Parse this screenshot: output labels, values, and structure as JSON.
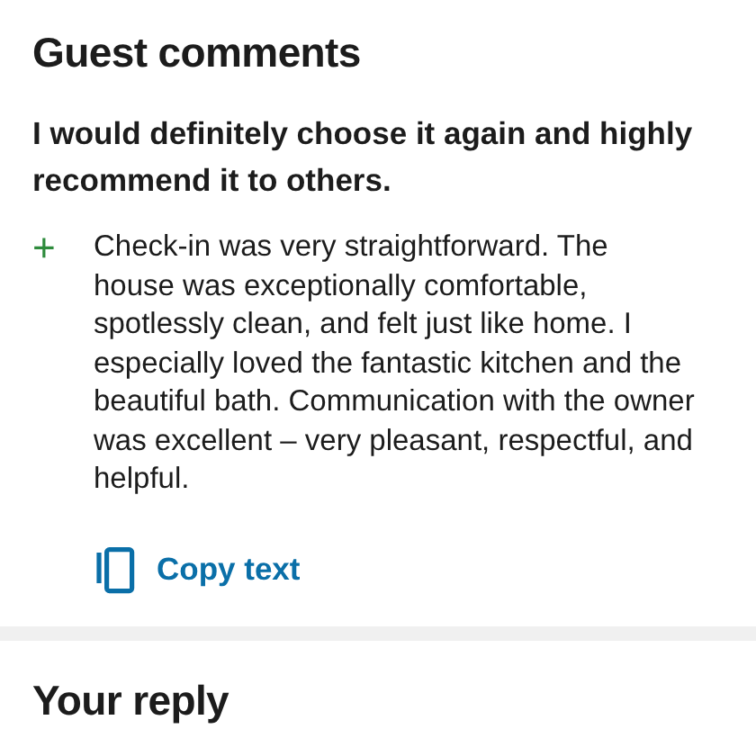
{
  "title": "Guest comments",
  "headline": "I would definitely choose it again and highly recommend it to others.",
  "positive_comment": {
    "sign": "+",
    "text": "Check-in was very straightforward. The house was exceptionally comfortable, spotlessly clean, and felt just like home. I especially loved the fantastic kitchen and the beautiful bath. Communication with the owner was excellent – very pleasant, respectful, and helpful."
  },
  "copy_button": "Copy text",
  "reply_title": "Your reply"
}
